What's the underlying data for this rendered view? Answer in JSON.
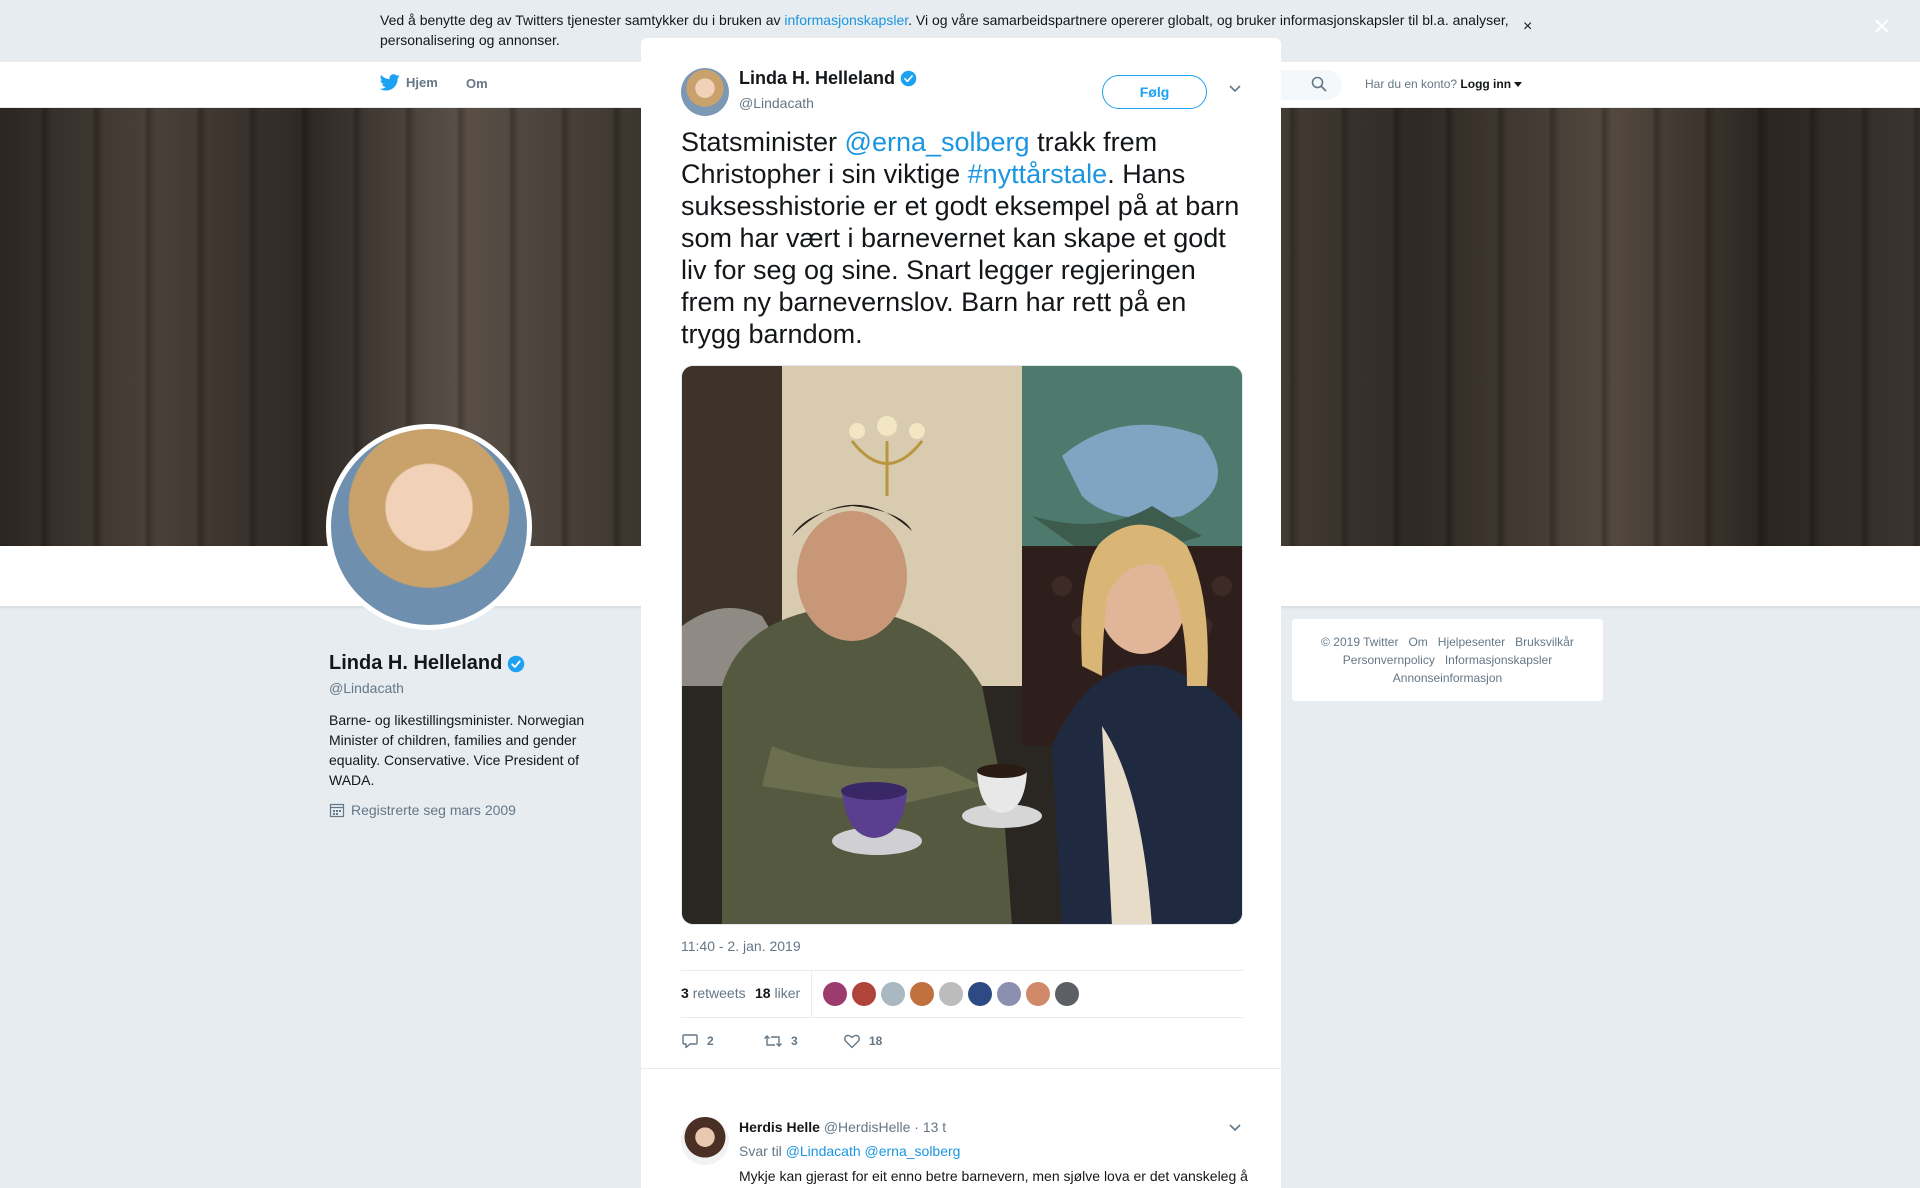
{
  "cookie": {
    "text_before": "Ved å benytte deg av Twitters tjenester samtykker du i bruken av ",
    "link": "informasjonskapsler",
    "text_after": ". Vi og våre samarbeidspartnere opererer globalt, og bruker informasjonskapsler til bl.a. analyser, personalisering og annonser.",
    "close": "×"
  },
  "nav": {
    "home": "Hjem",
    "about": "Om",
    "account_prompt": "Har du en konto?",
    "login": "Logg inn"
  },
  "profile": {
    "name": "Linda H. Helleland",
    "handle": "@Lindacath",
    "bio": "Barne- og likestillingsminister. Norwegian Minister of children, families and gender equality. Conservative. Vice President of WADA.",
    "joined": "Registrerte seg mars 2009"
  },
  "footer": {
    "links": [
      "© 2019 Twitter",
      "Om",
      "Hjelpesenter",
      "Bruksvilkår",
      "Personvernpolicy",
      "Informasjonskapsler",
      "Annonseinformasjon"
    ]
  },
  "modal": {
    "close": "×",
    "author": {
      "name": "Linda H. Helleland",
      "handle": "@Lindacath"
    },
    "follow": "Følg",
    "tweet": {
      "t1": "Statsminister ",
      "mention": "@erna_solberg",
      "t2": " trakk frem Christopher i sin viktige ",
      "hashtag": "#nyttårstale",
      "t3": ". Hans suksesshistorie er et godt eksempel på at barn som har vært i barnevernet kan skape et godt liv for seg og sine. Snart legger regjeringen frem ny barnevernslov. Barn har rett på en trygg barndom."
    },
    "timestamp": "11:40 - 2. jan. 2019",
    "stats": {
      "retweets_count": "3",
      "retweets_label": "retweets",
      "likes_count": "18",
      "likes_label": "liker"
    },
    "actions": {
      "replies": "2",
      "retweets": "3",
      "likes": "18"
    },
    "reply": {
      "name": "Herdis Helle",
      "handle": "@HerdisHelle",
      "time": "· 13 t",
      "reply_to_label": "Svar til",
      "reply_to_1": "@Lindacath",
      "reply_to_2": "@erna_solberg",
      "text": "Mykje kan gjerast for eit enno betre barnevern, men sjølve lova er det vanskeleg å sjå behov for gjennomgripande revisjon av. Bruk heller pengene som vil gå med på iverksetjing/opplæring i ny lov på betre tenester og høgare løn til dei"
    }
  },
  "colors": {
    "link": "#1b95e0",
    "follow": "#1da1f2",
    "verified": "#1da1f2"
  }
}
